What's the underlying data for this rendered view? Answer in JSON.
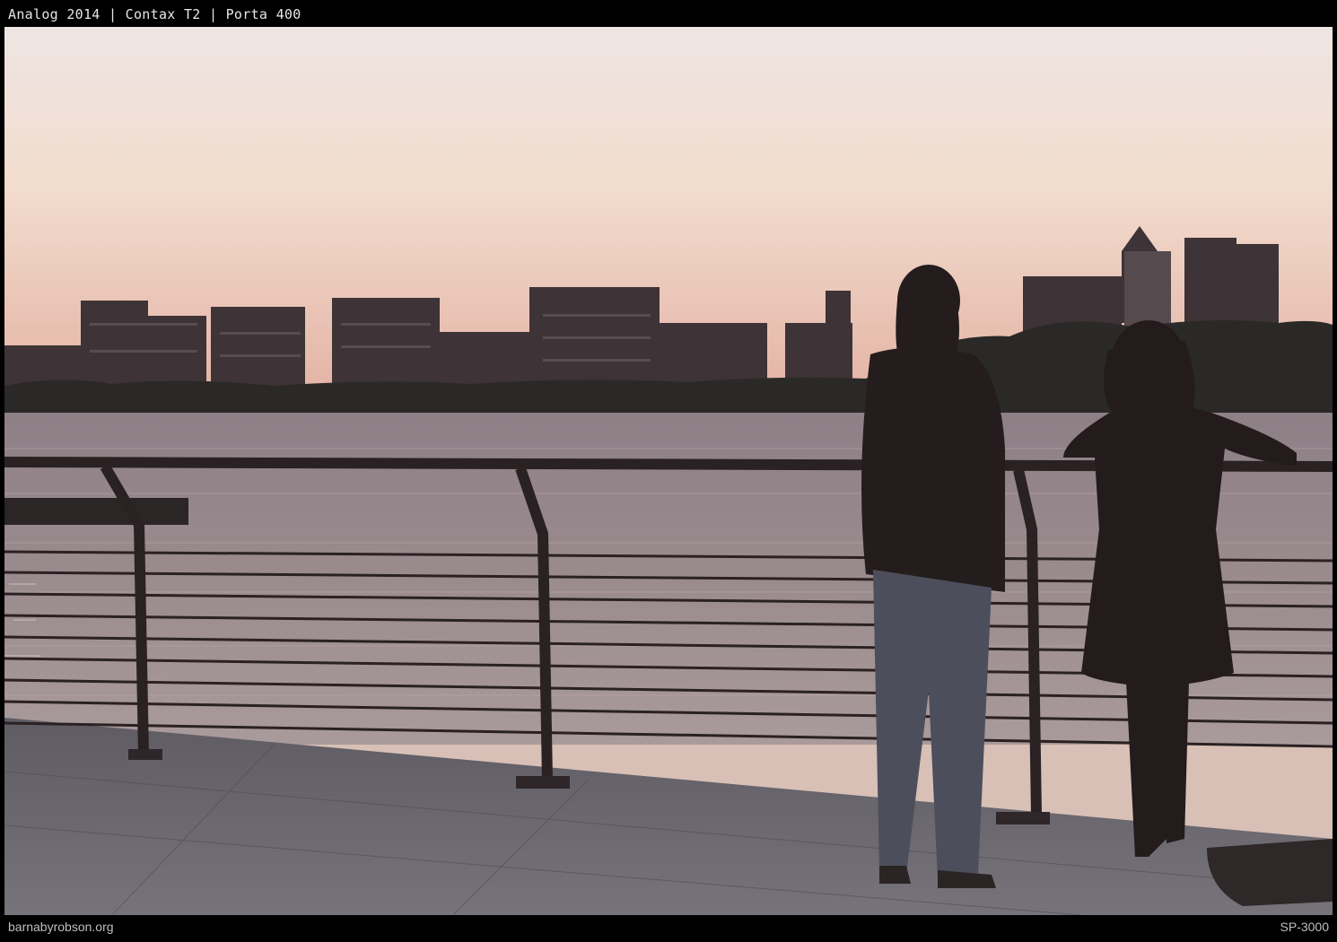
{
  "frame": {
    "caption": "Analog 2014 | Contax T2 | Porta 400",
    "site": "barnabyrobson.org",
    "code": "SP-3000"
  },
  "scene": {
    "subject": "two-people-at-river-railing",
    "colors": {
      "sky_top": "#efe4e0",
      "sky_mid": "#f1d9c8",
      "sky_horizon": "#e6b9a8",
      "buildings": "#3c3234",
      "trees": "#2a2a26",
      "water": "#8f8287",
      "water_light": "#b8a8aa",
      "railing": "#2b2224",
      "walkway": "#6c6870",
      "people": "#231c1d"
    }
  }
}
